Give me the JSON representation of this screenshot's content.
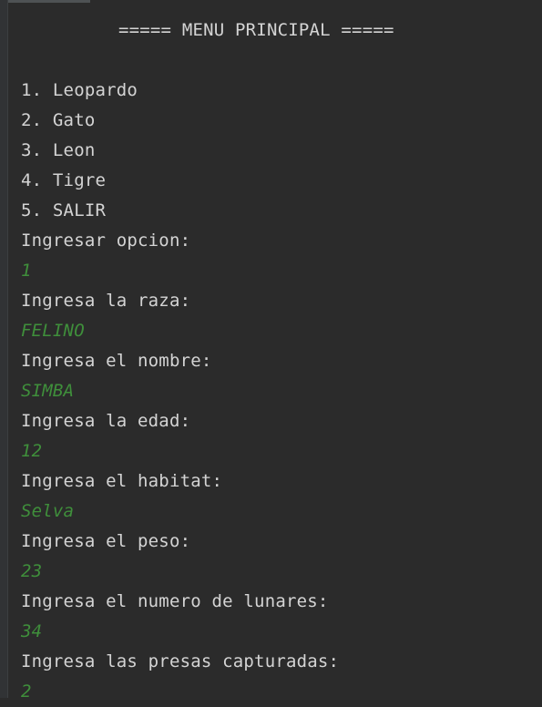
{
  "console": {
    "title": "===== MENU PRINCIPAL =====",
    "menu_items": [
      "1. Leopardo",
      "2. Gato",
      "3. Leon",
      "4. Tigre",
      "5. SALIR"
    ],
    "entries": [
      {
        "prompt": "Ingresar opcion:",
        "input": "1"
      },
      {
        "prompt": "Ingresa la raza:",
        "input": "FELINO"
      },
      {
        "prompt": "Ingresa el nombre:",
        "input": "SIMBA"
      },
      {
        "prompt": "Ingresa la edad:",
        "input": "12"
      },
      {
        "prompt": "Ingresa el habitat:",
        "input": "Selva"
      },
      {
        "prompt": "Ingresa el peso:",
        "input": "23"
      },
      {
        "prompt": "Ingresa el numero de lunares:",
        "input": "34"
      },
      {
        "prompt": "Ingresa las presas capturadas:",
        "input": "2"
      }
    ],
    "colors": {
      "background": "#2b2b2b",
      "output_text": "#d4d4d4",
      "user_input": "#3f8f3b"
    }
  }
}
